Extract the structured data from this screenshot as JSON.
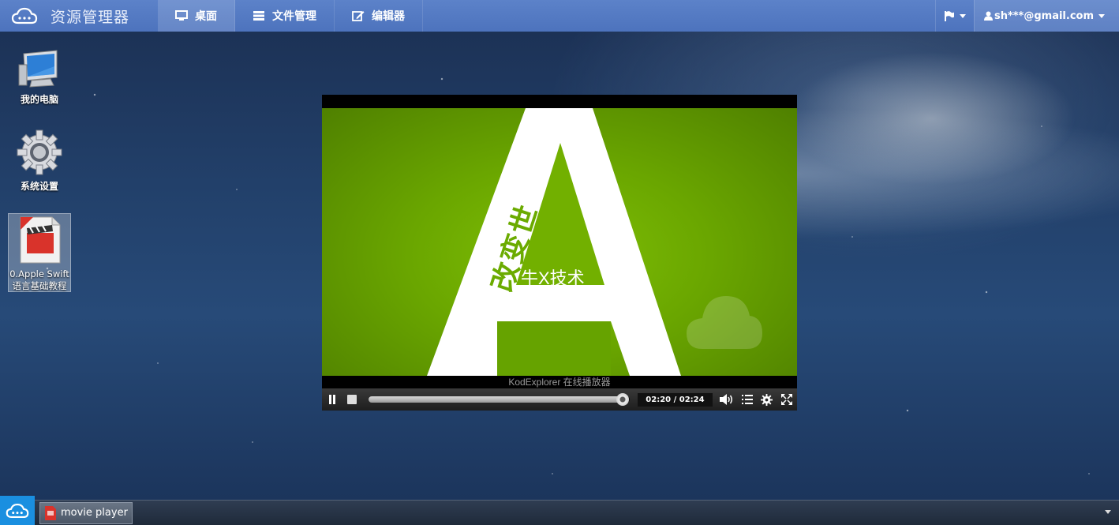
{
  "app": {
    "title": "资源管理器"
  },
  "nav": {
    "tabs": [
      {
        "label": "桌面",
        "icon": "monitor-icon",
        "active": true
      },
      {
        "label": "文件管理",
        "icon": "file-list-icon",
        "active": false
      },
      {
        "label": "编辑器",
        "icon": "edit-icon",
        "active": false
      }
    ],
    "user": "sh***@gmail.com",
    "flag_icon": "flag-icon"
  },
  "desktop": {
    "icons": [
      {
        "label": "我的电脑",
        "icon": "computer-icon"
      },
      {
        "label": "系统设置",
        "icon": "gear-icon"
      },
      {
        "label": "0.Apple Swift语言基础教程",
        "icon": "video-file-icon",
        "selected": true
      }
    ]
  },
  "player": {
    "video_text": {
      "big_letter": "A",
      "slogan": "改变世",
      "subtitle": "牛X技术"
    },
    "caption": "KodExplorer 在线播放器",
    "time": "02:20 / 02:24",
    "progress": 0.972
  },
  "taskbar": {
    "items": [
      {
        "label": "movie player",
        "icon": "video-file-icon"
      }
    ]
  },
  "colors": {
    "navbar": "#5c82c9",
    "video_green": "#6aa600",
    "start": "#1a8fe0"
  }
}
